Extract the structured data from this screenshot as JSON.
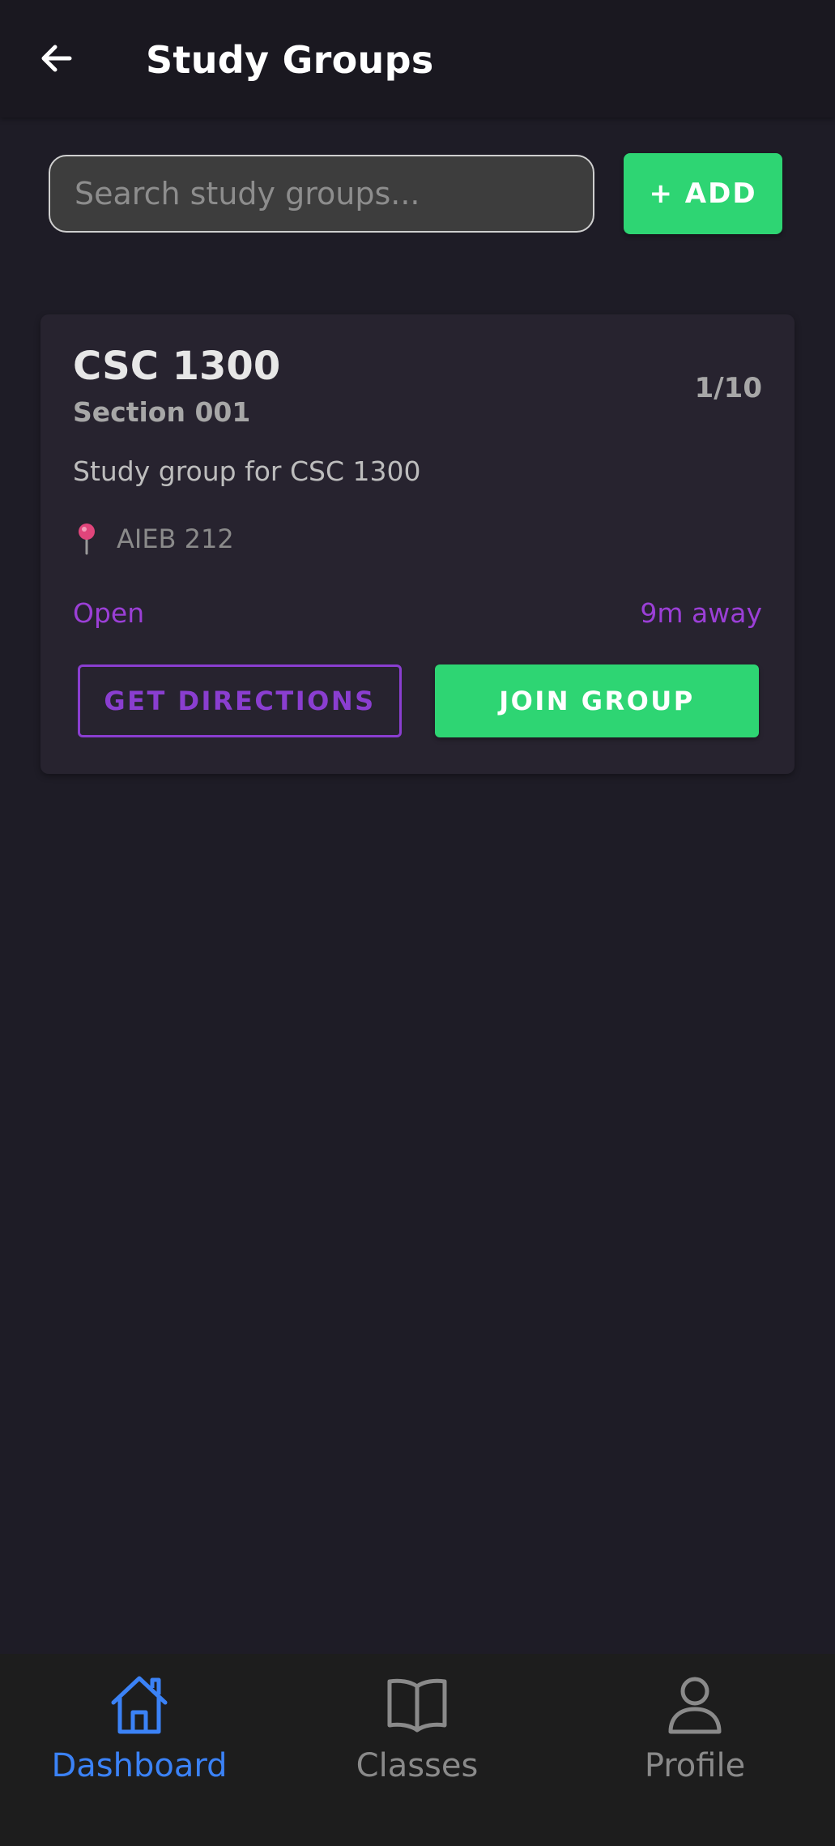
{
  "header": {
    "title": "Study Groups",
    "back_icon": "arrow-left-icon"
  },
  "search": {
    "placeholder": "Search study groups...",
    "value": ""
  },
  "toolbar": {
    "add_label": "+ ADD"
  },
  "groups": [
    {
      "course": "CSC 1300",
      "section": "Section 001",
      "members": "1/10",
      "description": "Study group for CSC 1300",
      "location_icon": "map-pin-icon",
      "location": "AIEB 212",
      "status": "Open",
      "distance": "9m away",
      "directions_label": "GET DIRECTIONS",
      "join_label": "JOIN GROUP"
    }
  ],
  "nav": {
    "items": [
      {
        "label": "Dashboard",
        "icon": "home-icon",
        "active": true
      },
      {
        "label": "Classes",
        "icon": "book-icon",
        "active": false
      },
      {
        "label": "Profile",
        "icon": "user-icon",
        "active": false
      }
    ]
  },
  "colors": {
    "background": "#1e1c26",
    "header_bg": "#1a1820",
    "card_bg": "#27232f",
    "accent_green": "#2ed573",
    "accent_purple": "#8a3ed0",
    "status_purple": "#9b3fd6",
    "nav_active": "#3b82f6",
    "nav_inactive": "#8a8a8a",
    "pin_red": "#e0457b"
  }
}
